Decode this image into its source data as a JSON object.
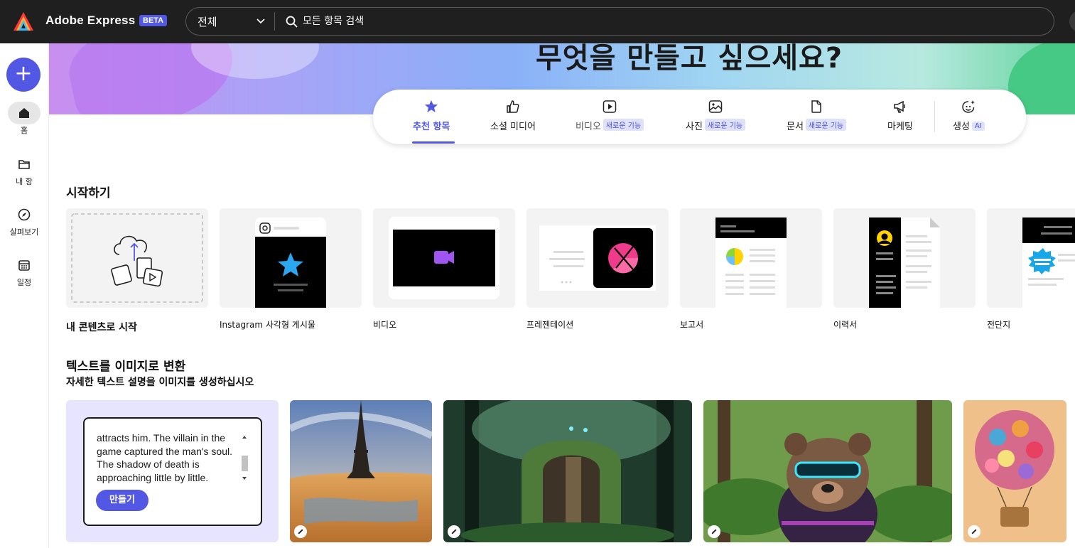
{
  "app": {
    "name": "Adobe Express",
    "badge": "BETA"
  },
  "search": {
    "scope": "전체",
    "placeholder": "모든 항목 검색"
  },
  "rail": {
    "create_label": "+",
    "items": [
      {
        "label": "홈",
        "icon": "home-icon",
        "active": true
      },
      {
        "label": "내 항",
        "icon": "folder-icon"
      },
      {
        "label": "살펴보기",
        "icon": "compass-icon"
      },
      {
        "label": "일정",
        "icon": "calendar-icon"
      }
    ]
  },
  "hero": {
    "title": "무엇을 만들고 싶으세요?"
  },
  "tabs": [
    {
      "label": "추천 항목",
      "icon": "star-icon",
      "active": true
    },
    {
      "label": "소셜 미디어",
      "icon": "thumbs-up-icon"
    },
    {
      "label": "비디오",
      "icon": "play-icon",
      "badge": "새로운 기능"
    },
    {
      "label": "사진",
      "icon": "photo-icon",
      "badge": "새로운 기능"
    },
    {
      "label": "문서",
      "icon": "document-icon",
      "badge": "새로운 기능"
    },
    {
      "label": "마케팅",
      "icon": "megaphone-icon"
    },
    {
      "label": "생성",
      "icon": "sparkle-icon",
      "badge": "AI"
    }
  ],
  "start": {
    "title": "시작하기",
    "cards": [
      {
        "label": "내 콘텐츠로 시작"
      },
      {
        "label": "Instagram 사각형 게시물"
      },
      {
        "label": "비디오"
      },
      {
        "label": "프레젠테이션"
      },
      {
        "label": "보고서"
      },
      {
        "label": "이력서"
      },
      {
        "label": "전단지"
      }
    ]
  },
  "text_to_image": {
    "title": "텍스트를 이미지로 변환",
    "subtitle": "자세한 텍스트 설명을 이미지를 생성하십시오",
    "prompt_text": "attracts him. The villain in the game captured the man's soul. The shadow of death is approaching little by little.",
    "button_label": "만들기"
  },
  "colors": {
    "accent": "#5258e4",
    "topbar": "#1f1f1f",
    "panel": "#e6e4ff"
  }
}
